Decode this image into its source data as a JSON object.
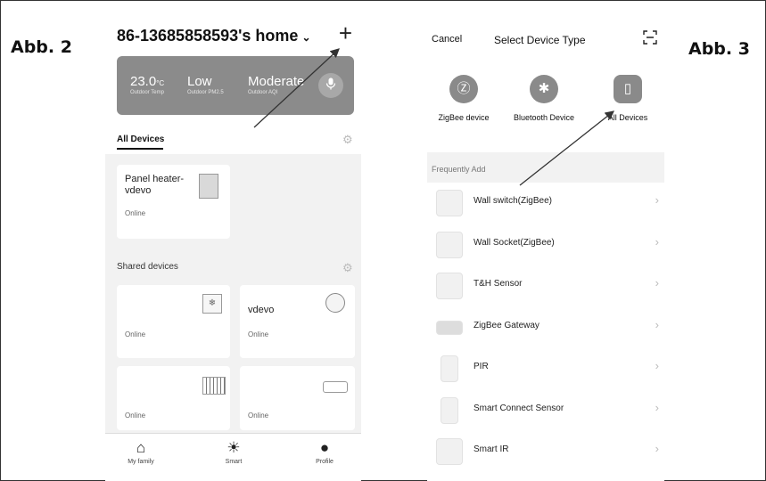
{
  "figures": {
    "left_label": "Abb. 2",
    "right_label": "Abb. 3"
  },
  "home": {
    "title": "86-13685858593's home",
    "caret": "⌄",
    "add_icon": "+",
    "weather": [
      {
        "value": "23.0",
        "unit": "°C",
        "label": "Outdoor Temp"
      },
      {
        "value": "Low",
        "unit": "",
        "label": "Outdoor PM2.5"
      },
      {
        "value": "Moderate",
        "unit": "",
        "label": "Outdoor AQI"
      }
    ],
    "tab_all_devices": "All Devices",
    "shared_devices": "Shared devices",
    "device_panel_name": "Panel heater-vdevo",
    "device_panel_status": "Online",
    "shared_cards": [
      {
        "name": "",
        "status": "Online"
      },
      {
        "name": "vdevo",
        "status": "Online"
      },
      {
        "name": "",
        "status": "Online"
      },
      {
        "name": "",
        "status": "Online"
      }
    ],
    "nav": {
      "my_family": "My family",
      "smart": "Smart",
      "profile": "Profile"
    }
  },
  "select": {
    "cancel": "Cancel",
    "title": "Select Device Type",
    "categories": [
      {
        "label": "ZigBee device",
        "icon": "zigbee-icon"
      },
      {
        "label": "Bluetooth Device",
        "icon": "bluetooth-icon"
      },
      {
        "label": "All Devices",
        "icon": "all-devices-icon"
      }
    ],
    "frequently_add": "Frequently Add",
    "items": [
      "Wall switch(ZigBee)",
      "Wall Socket(ZigBee)",
      "T&H Sensor",
      "ZigBee Gateway",
      "PIR",
      "Smart Connect Sensor",
      "Smart IR"
    ]
  }
}
